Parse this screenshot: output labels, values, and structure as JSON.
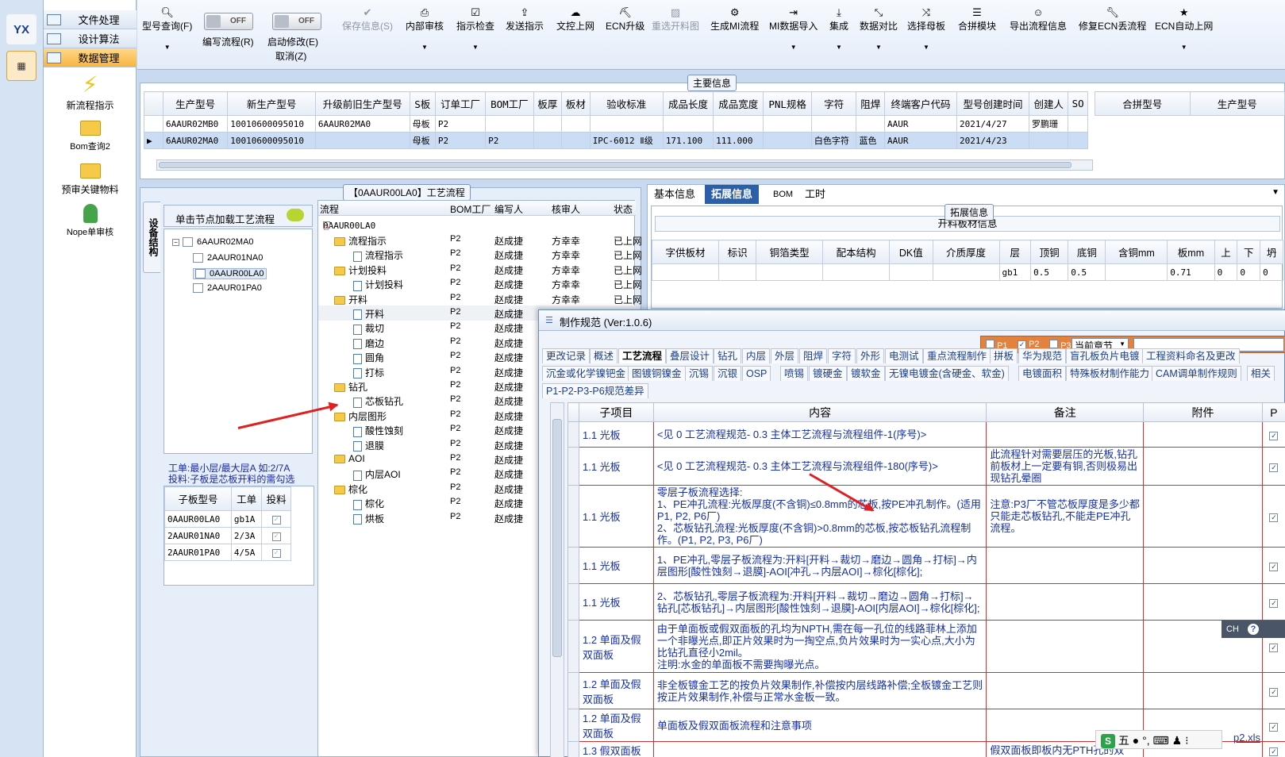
{
  "nav": {
    "headers": [
      "文件处理",
      "设计算法",
      "数据管理"
    ],
    "items": [
      {
        "label": "新流程指示",
        "icon": "lightning-icon"
      },
      {
        "label": "Bom查询2",
        "icon": "folder-icon"
      },
      {
        "label": "预审关键物料",
        "icon": "folder-icon"
      },
      {
        "label": "Nope单审核",
        "icon": "user-icon"
      }
    ],
    "logo": "YX"
  },
  "toolbar": {
    "items": [
      "型号查询(F)",
      "编写流程(R)",
      "启动修改(E)",
      "取消(Z)",
      "保存信息(S)",
      "内部审核",
      "指示检查",
      "发送指示",
      "文控上网",
      "ECN升级",
      "重选开料图",
      "生成MI流程",
      "MI数据导入",
      "集成",
      "数据对比",
      "选择母板",
      "合拼模块",
      "导出流程信息",
      "修复ECN丢流程",
      "ECN自动上网"
    ],
    "toggle_off": "OFF"
  },
  "main_info": {
    "title": "主要信息",
    "columns": [
      "生产型号",
      "新生产型号",
      "升级前旧生产型号",
      "S板",
      "订单工厂",
      "BOM工厂",
      "板厚",
      "板材",
      "验收标准",
      "成品长度",
      "成品宽度",
      "PNL规格",
      "字符",
      "阻焊",
      "终端客户代码",
      "型号创建时间",
      "创建人",
      "SO"
    ],
    "rows": [
      [
        "6AAUR02MB0",
        "10010600095010",
        "6AAUR02MA0",
        "母板",
        "P2",
        "",
        "",
        "",
        "",
        "",
        "",
        "",
        "",
        "",
        "AAUR",
        "2021/4/27",
        "罗鹏珊",
        ""
      ],
      [
        "6AAUR02MA0",
        "10010600095010",
        "",
        "母板",
        "P2",
        "P2",
        "",
        "",
        "IPC-6012 Ⅱ级",
        "171.100",
        "111.000",
        "",
        "白色字符",
        "蓝色",
        "AAUR",
        "2021/4/23",
        "",
        ""
      ]
    ],
    "side_columns": [
      "合拼型号",
      "生产型号"
    ]
  },
  "struct": {
    "vtab": "设备结构",
    "hint": "单击节点加载工艺流程",
    "tree": [
      "6AAUR02MA0",
      "2AAUR01NA0",
      "0AAUR00LA0",
      "2AAUR01PA0"
    ],
    "note1": "工单:最小层/最大层A 如:2/7A",
    "note2": "投料:子板是芯板开料的需勾选",
    "sub_columns": [
      "子板型号",
      "工单",
      "投料"
    ],
    "sub_rows": [
      [
        "0AAUR00LA0",
        "gb1A"
      ],
      [
        "2AAUR01NA0",
        "2/3A"
      ],
      [
        "2AAUR01PA0",
        "4/5A"
      ]
    ]
  },
  "process": {
    "title": "【0AAUR00LA0】工艺流程",
    "columns": [
      "流程",
      "BOM工厂",
      "编写人",
      "核审人",
      "状态"
    ],
    "root": "0AAUR00LA0",
    "rows": [
      {
        "name": "流程指示",
        "type": "folder",
        "bom": "P2",
        "writer": "赵成捷",
        "reviewer": "方幸幸",
        "status": "已上网"
      },
      {
        "name": "流程指示",
        "type": "doc",
        "bom": "P2",
        "writer": "赵成捷",
        "reviewer": "方幸幸",
        "status": "已上网"
      },
      {
        "name": "计划投料",
        "type": "folder",
        "bom": "P2",
        "writer": "赵成捷",
        "reviewer": "方幸幸",
        "status": "已上网"
      },
      {
        "name": "计划投料",
        "type": "doc",
        "bom": "P2",
        "writer": "赵成捷",
        "reviewer": "方幸幸",
        "status": "已上网"
      },
      {
        "name": "开料",
        "type": "folder",
        "bom": "P2",
        "writer": "赵成捷",
        "reviewer": "方幸幸",
        "status": "已上网"
      },
      {
        "name": "开料",
        "type": "doc",
        "bom": "P2",
        "writer": "赵成捷",
        "reviewer": "",
        "status": ""
      },
      {
        "name": "裁切",
        "type": "doc",
        "bom": "P2",
        "writer": "赵成捷",
        "reviewer": "",
        "status": ""
      },
      {
        "name": "磨边",
        "type": "doc",
        "bom": "P2",
        "writer": "赵成捷",
        "reviewer": "",
        "status": ""
      },
      {
        "name": "圆角",
        "type": "doc",
        "bom": "P2",
        "writer": "赵成捷",
        "reviewer": "",
        "status": ""
      },
      {
        "name": "打标",
        "type": "doc",
        "bom": "P2",
        "writer": "赵成捷",
        "reviewer": "",
        "status": ""
      },
      {
        "name": "钻孔",
        "type": "folder",
        "bom": "P2",
        "writer": "赵成捷",
        "reviewer": "",
        "status": ""
      },
      {
        "name": "芯板钻孔",
        "type": "doc",
        "bom": "P2",
        "writer": "赵成捷",
        "reviewer": "",
        "status": ""
      },
      {
        "name": "内层图形",
        "type": "folder",
        "bom": "P2",
        "writer": "赵成捷",
        "reviewer": "",
        "status": ""
      },
      {
        "name": "酸性蚀刻",
        "type": "doc",
        "bom": "P2",
        "writer": "赵成捷",
        "reviewer": "",
        "status": ""
      },
      {
        "name": "退膜",
        "type": "doc",
        "bom": "P2",
        "writer": "赵成捷",
        "reviewer": "",
        "status": ""
      },
      {
        "name": "AOI",
        "type": "folder",
        "bom": "P2",
        "writer": "赵成捷",
        "reviewer": "",
        "status": ""
      },
      {
        "name": "内层AOI",
        "type": "doc",
        "bom": "P2",
        "writer": "赵成捷",
        "reviewer": "",
        "status": ""
      },
      {
        "name": "棕化",
        "type": "folder",
        "bom": "P2",
        "writer": "赵成捷",
        "reviewer": "",
        "status": ""
      },
      {
        "name": "棕化",
        "type": "doc",
        "bom": "P2",
        "writer": "赵成捷",
        "reviewer": "",
        "status": ""
      },
      {
        "name": "烘板",
        "type": "doc",
        "bom": "P2",
        "writer": "赵成捷",
        "reviewer": "",
        "status": ""
      }
    ]
  },
  "right": {
    "tabs": [
      "基本信息",
      "拓展信息",
      "BOM",
      "工时"
    ],
    "ext_title": "拓展信息",
    "sub_title": "开料板材信息",
    "columns": [
      "字供板材",
      "标识",
      "铜箔类型",
      "配本结构",
      "DK值",
      "介质厚度",
      "层",
      "顶铜",
      "底铜",
      "含铜mm",
      "板mm",
      "上",
      "下",
      "坍"
    ],
    "row": [
      "",
      "",
      "",
      "",
      "",
      "",
      "gb1",
      "0.5",
      "0.5",
      "",
      "0.71",
      "0",
      "0",
      "0"
    ]
  },
  "dialog": {
    "title": "制作规范 (Ver:1.0.6)",
    "p1": "P1",
    "p2": "P2",
    "p3": "P3",
    "chapter": "当前章节",
    "tabs_row1": [
      "更改记录",
      "概述",
      "工艺流程",
      "叠层设计",
      "钻孔",
      "内层",
      "外层",
      "阻焊",
      "字符",
      "外形",
      "电测试",
      "重点流程制作",
      "拼板",
      "华为规范",
      "盲孔板负片电镀",
      "工程资料命名及更改"
    ],
    "tabs_row2": [
      "沉金或化学镍钯金",
      "图镀铜镍金",
      "沉锡",
      "沉银",
      "OSP",
      "喷锡",
      "镀硬金",
      "镀软金",
      "无镍电镀金(含硬金、软金)",
      "电镀面积",
      "特殊板材制作能力",
      "CAM调单制作规则",
      "相关"
    ],
    "tabs_row3": [
      "P1-P2-P3-P6规范差异"
    ],
    "columns": [
      "子项目",
      "内容",
      "备注",
      "附件",
      "P"
    ],
    "rows": [
      {
        "sub": "1.1 光板",
        "content": "<见 0 工艺流程规范- 0.3 主体工艺流程与流程组件-1(序号)>",
        "note": ""
      },
      {
        "sub": "1.1 光板",
        "content": "<见 0 工艺流程规范- 0.3 主体工艺流程与流程组件-180(序号)>",
        "note": "此流程针对需要层压的光板,钻孔前板材上一定要有铜,否则极易出现钻孔晕圈"
      },
      {
        "sub": "1.1 光板",
        "content": "零层子板流程选择:\n1、PE冲孔流程:光板厚度(不含铜)≤0.8mm的芯板,按PE冲孔制作。(适用P1, P2, P6厂)\n2、芯板钻孔流程:光板厚度(不含铜)>0.8mm的芯板,按芯板钻孔流程制作。(P1, P2, P3, P6厂)",
        "note": "注意:P3厂不管芯板厚度是多少都只能走芯板钻孔,不能走PE冲孔流程。"
      },
      {
        "sub": "1.1 光板",
        "content": "1、PE冲孔,零层子板流程为:开料[开料→裁切→磨边→圆角→打标]→内层图形[酸性蚀刻→退膜]-AOI[冲孔→内层AOI]→棕化[棕化];",
        "note": ""
      },
      {
        "sub": "1.1 光板",
        "content": "2、芯板钻孔,零层子板流程为:开料[开料→裁切→磨边→圆角→打标]→钻孔[芯板钻孔]→内层图形[酸性蚀刻→退膜]-AOI[内层AOI]→棕化[棕化];",
        "note": ""
      },
      {
        "sub": "1.2 单面及假双面板",
        "content": "由于单面板或假双面板的孔均为NPTH,需在每一孔位的线路菲林上添加一个非曝光点,即正片效果时为一掏空点,负片效果时为一实心点,大小为比钻孔直径小2mil。\n注明:水金的单面板不需要掏曝光点。",
        "note": ""
      },
      {
        "sub": "1.2 单面及假双面板",
        "content": "非全板镀金工艺的按负片效果制作,补偿按内层线路补偿;全板镀金工艺则按正片效果制作,补偿与正常水金板一致。",
        "note": ""
      },
      {
        "sub": "1.2 单面及假双面板",
        "content": "单面板及假双面板流程和注意事项",
        "note": ""
      },
      {
        "sub": "1.3 假双面板",
        "content": "",
        "note": "假双面板即板内无PTH孔的双"
      }
    ],
    "attach_partial": "p2.xls"
  },
  "ime": {
    "ch": "CH",
    "mode": "五"
  }
}
